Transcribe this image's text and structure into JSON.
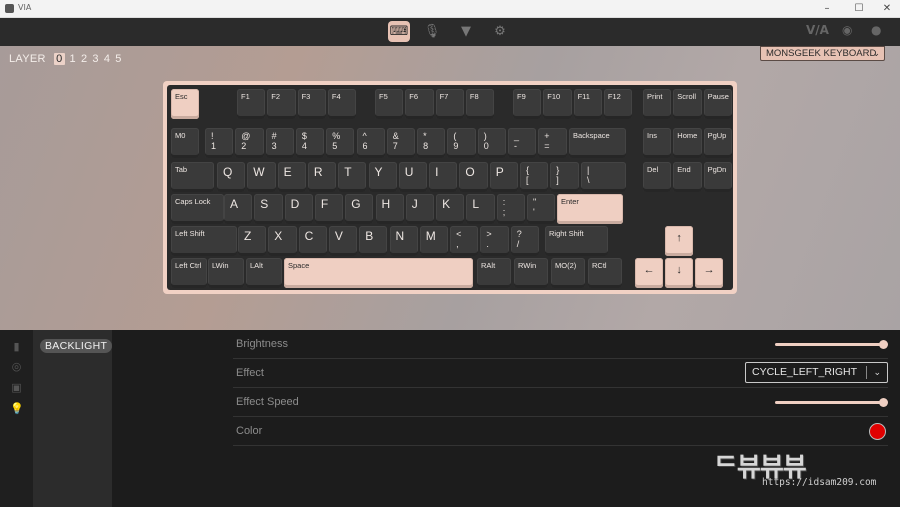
{
  "window": {
    "title": "VIA",
    "controls": [
      "minimize",
      "maximize",
      "close"
    ]
  },
  "toolbar": {
    "tabs": [
      {
        "icon": "keyboard-icon",
        "active": true
      },
      {
        "icon": "microphone-icon",
        "active": false
      },
      {
        "icon": "pin-icon",
        "active": false
      },
      {
        "icon": "gear-icon",
        "active": false
      }
    ],
    "right_links": [
      "VIA",
      "discord-icon",
      "github-icon"
    ],
    "via_label": "V/A"
  },
  "layers": {
    "label": "LAYER",
    "numbers": [
      "0",
      "1",
      "2",
      "3",
      "4",
      "5"
    ],
    "active": "0"
  },
  "keyboard_select": {
    "value": "MONSGEEK KEYBOARD"
  },
  "keys": [
    {
      "label": "Esc",
      "light": true
    },
    {
      "label": "F1"
    },
    {
      "label": "F2"
    },
    {
      "label": "F3"
    },
    {
      "label": "F4"
    },
    {
      "label": "F5"
    },
    {
      "label": "F6"
    },
    {
      "label": "F7"
    },
    {
      "label": "F8"
    },
    {
      "label": "F9"
    },
    {
      "label": "F10"
    },
    {
      "label": "F11"
    },
    {
      "label": "F12"
    },
    {
      "label": "Print"
    },
    {
      "label": "Scroll"
    },
    {
      "label": "Pause"
    },
    {
      "label": "M0"
    },
    {
      "label": "!\n1"
    },
    {
      "label": "@\n2"
    },
    {
      "label": "#\n3"
    },
    {
      "label": "$\n4"
    },
    {
      "label": "%\n5"
    },
    {
      "label": "^\n6"
    },
    {
      "label": "&\n7"
    },
    {
      "label": "*\n8"
    },
    {
      "label": "(\n9"
    },
    {
      "label": ")\n0"
    },
    {
      "label": "_\n-"
    },
    {
      "label": "+\n="
    },
    {
      "label": "Backspace"
    },
    {
      "label": "Ins"
    },
    {
      "label": "Home"
    },
    {
      "label": "PgUp"
    },
    {
      "label": "Tab"
    },
    {
      "label": "Q"
    },
    {
      "label": "W"
    },
    {
      "label": "E"
    },
    {
      "label": "R"
    },
    {
      "label": "T"
    },
    {
      "label": "Y"
    },
    {
      "label": "U"
    },
    {
      "label": "I"
    },
    {
      "label": "O"
    },
    {
      "label": "P"
    },
    {
      "label": "{\n["
    },
    {
      "label": "}\n]"
    },
    {
      "label": "|\n\\"
    },
    {
      "label": "Del"
    },
    {
      "label": "End"
    },
    {
      "label": "PgDn"
    },
    {
      "label": "Caps Lock"
    },
    {
      "label": "A"
    },
    {
      "label": "S"
    },
    {
      "label": "D"
    },
    {
      "label": "F"
    },
    {
      "label": "G"
    },
    {
      "label": "H"
    },
    {
      "label": "J"
    },
    {
      "label": "K"
    },
    {
      "label": "L"
    },
    {
      "label": ":\n;"
    },
    {
      "label": "\"\n'"
    },
    {
      "label": "Enter",
      "light": true
    },
    {
      "label": "Left Shift"
    },
    {
      "label": "Z"
    },
    {
      "label": "X"
    },
    {
      "label": "C"
    },
    {
      "label": "V"
    },
    {
      "label": "B"
    },
    {
      "label": "N"
    },
    {
      "label": "M"
    },
    {
      "label": "<\n,"
    },
    {
      "label": ">\n."
    },
    {
      "label": "?\n/"
    },
    {
      "label": "Right Shift"
    },
    {
      "label": "↑",
      "light": true
    },
    {
      "label": "Left Ctrl"
    },
    {
      "label": "LWin"
    },
    {
      "label": "LAlt"
    },
    {
      "label": "Space",
      "light": true
    },
    {
      "label": "RAlt"
    },
    {
      "label": "RWin"
    },
    {
      "label": "MO(2)"
    },
    {
      "label": "RCtl"
    },
    {
      "label": "←",
      "light": true
    },
    {
      "label": "↓",
      "light": true
    },
    {
      "label": "→",
      "light": true
    }
  ],
  "sidebar": {
    "submenu_label": "BACKLIGHT"
  },
  "settings": {
    "rows": [
      {
        "label": "Brightness",
        "control": "slider",
        "value": 1.0
      },
      {
        "label": "Effect",
        "control": "select",
        "value": "CYCLE_LEFT_RIGHT"
      },
      {
        "label": "Effect Speed",
        "control": "slider",
        "value": 1.0
      },
      {
        "label": "Color",
        "control": "color",
        "value": "#e00000"
      }
    ]
  },
  "watermark": {
    "url": "https://idsam209.com"
  },
  "colors": {
    "accent": "#efcfc2",
    "key_dark": "#3a3a3a",
    "panel_bg": "#1c1c1c",
    "color_swatch": "#e00000"
  }
}
